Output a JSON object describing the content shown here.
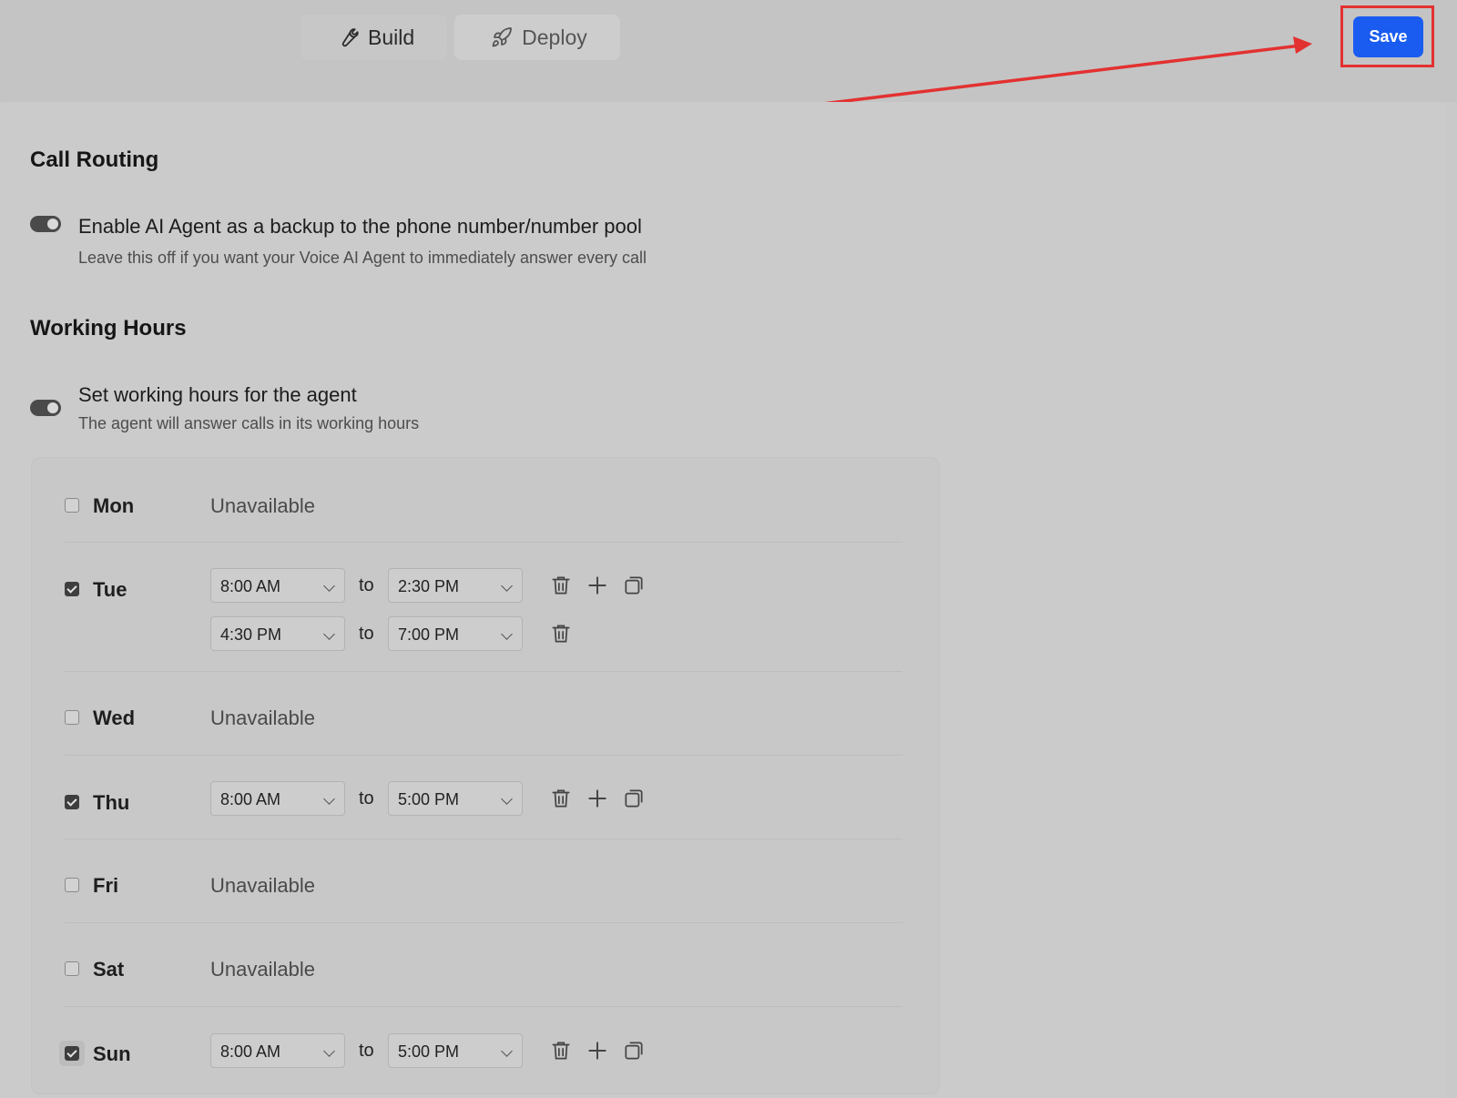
{
  "tabs": [
    {
      "label": "Build",
      "icon": "wrench-icon",
      "active": true
    },
    {
      "label": "Deploy",
      "icon": "rocket-icon",
      "active": false
    }
  ],
  "save_label": "Save",
  "colors": {
    "accent": "#1a5cf0",
    "annotation": "#e33131"
  },
  "call_routing": {
    "heading": "Call Routing",
    "toggle_title": "Enable AI Agent as a backup to the phone number/number pool",
    "toggle_desc": "Leave this off if you want your Voice AI Agent to immediately answer every call"
  },
  "working_hours": {
    "heading": "Working Hours",
    "toggle_title": "Set working hours for the agent",
    "toggle_desc": "The agent will answer calls in its working hours",
    "to_label": "to",
    "unavailable_label": "Unavailable",
    "days": [
      {
        "name": "Mon",
        "checked": false
      },
      {
        "name": "Tue",
        "checked": true,
        "slots": [
          {
            "from": "8:00 AM",
            "to": "2:30 PM"
          },
          {
            "from": "4:30 PM",
            "to": "7:00 PM"
          }
        ]
      },
      {
        "name": "Wed",
        "checked": false
      },
      {
        "name": "Thu",
        "checked": true,
        "slots": [
          {
            "from": "8:00 AM",
            "to": "5:00 PM"
          }
        ]
      },
      {
        "name": "Fri",
        "checked": false
      },
      {
        "name": "Sat",
        "checked": false
      },
      {
        "name": "Sun",
        "checked": true,
        "slots": [
          {
            "from": "8:00 AM",
            "to": "5:00 PM"
          }
        ]
      }
    ]
  }
}
